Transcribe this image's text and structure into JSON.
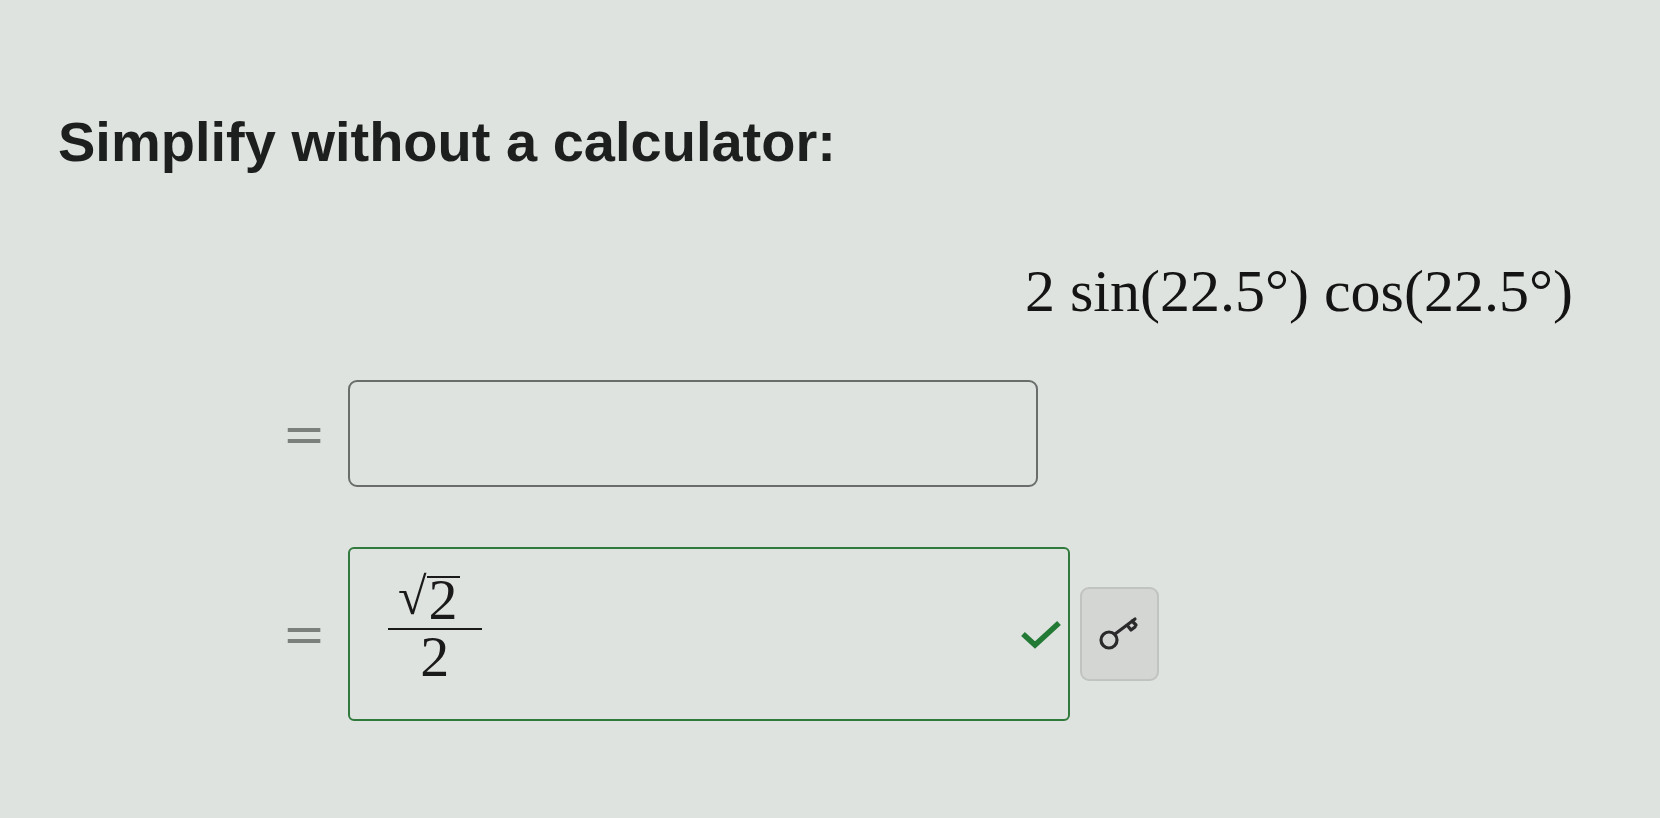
{
  "prompt": "Simplify without a calculator:",
  "expression": "2 sin(22.5°) cos(22.5°)",
  "answers": [
    {
      "relation": "=",
      "kind": "blank",
      "correct": false
    },
    {
      "relation": "=",
      "kind": "fraction",
      "correct": true,
      "numerator": {
        "radical": "√",
        "radicand": "2"
      },
      "denominator": "2",
      "answer_key_button": true
    }
  ]
}
